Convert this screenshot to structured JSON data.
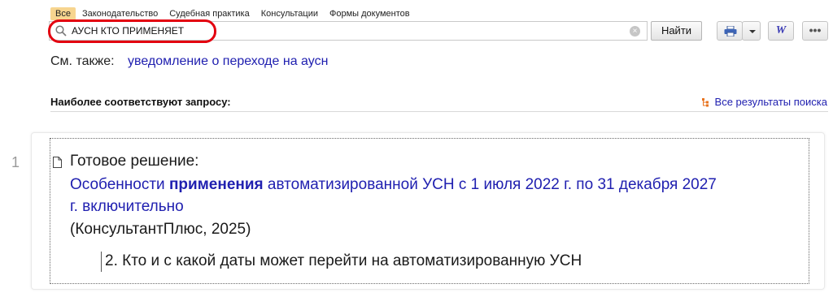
{
  "tabs": [
    {
      "label": "Все",
      "active": true
    },
    {
      "label": "Законодательство"
    },
    {
      "label": "Судебная практика"
    },
    {
      "label": "Консультации"
    },
    {
      "label": "Формы документов"
    }
  ],
  "search": {
    "value": "АУСН КТО ПРИМЕНЯЕТ",
    "icon": "search-icon",
    "clear_icon": "×"
  },
  "toolbar": {
    "find_label": "Найти",
    "word_label": "W",
    "more_label": "•••"
  },
  "see_also": {
    "label": "См. также:",
    "link": "уведомление о переходе на аусн"
  },
  "results_header": {
    "label": "Наиболее соответствуют запросу:",
    "all_results": "Все результаты поиска"
  },
  "results": [
    {
      "number": "1",
      "type": "Готовое решение:",
      "title_before": "Особенности ",
      "title_bold": "применения",
      "title_after": " автоматизированной УСН с 1 июля 2022 г. по 31 декабря 2027 г. включительно",
      "source": "(КонсультантПлюс, 2025)",
      "sub_item": "2. Кто и с какой даты может перейти на автоматизированную УСН"
    }
  ],
  "colors": {
    "link": "#2020b0",
    "active_tab": "#f7d58f",
    "highlight": "#e3000f"
  }
}
